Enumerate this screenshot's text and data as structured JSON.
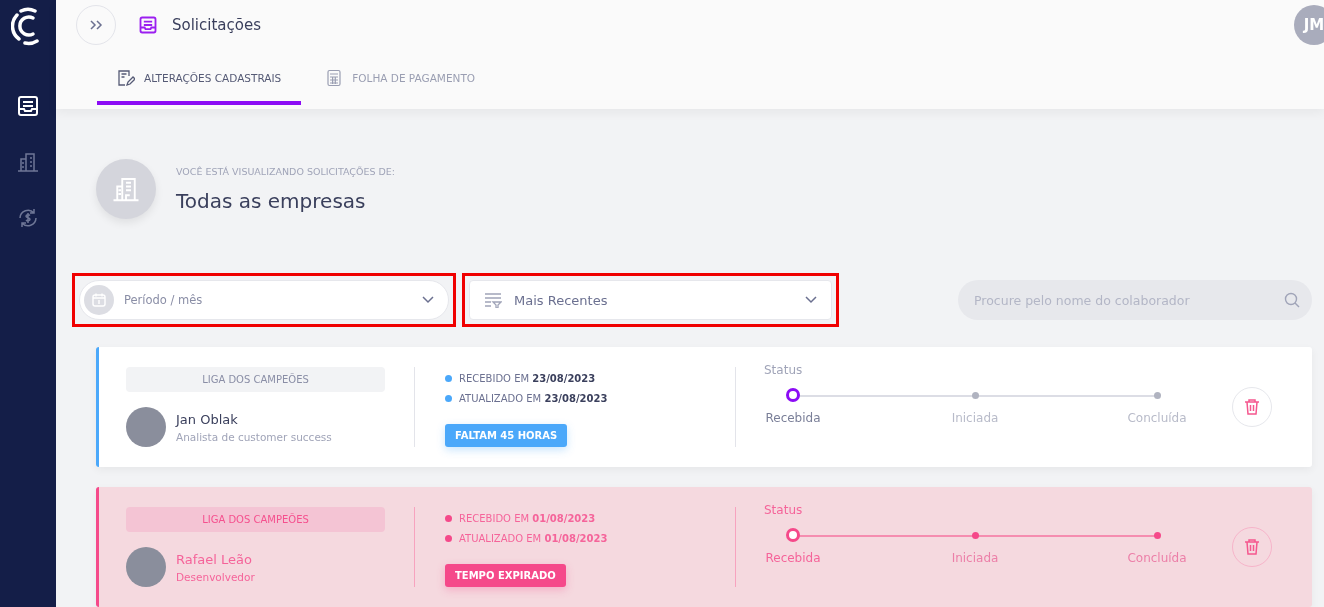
{
  "header": {
    "title": "Solicitações",
    "user_initials": "JM"
  },
  "tabs": [
    {
      "label": "ALTERAÇÕES CADASTRAIS",
      "selected": true,
      "kind": "edit"
    },
    {
      "label": "FOLHA DE PAGAMENTO",
      "selected": false,
      "kind": "calc"
    }
  ],
  "sidebar": {
    "items": [
      {
        "kind": "inbox",
        "selected": true
      },
      {
        "kind": "building",
        "selected": false
      },
      {
        "kind": "money",
        "selected": false
      }
    ]
  },
  "viewing": {
    "caption": "VOCÊ ESTÁ VISUALIZANDO SOLICITAÇÕES DE:",
    "company": "Todas as empresas"
  },
  "filters": {
    "period": {
      "placeholder": "Período / mês",
      "highlighted": true
    },
    "sort": {
      "value": "Mais Recentes",
      "highlighted": true
    },
    "search": {
      "placeholder": "Procure pelo nome do colaborador"
    }
  },
  "requests": [
    {
      "kind": "pending",
      "company": "LIGA DOS CAMPEÕES",
      "name": "Jan Oblak",
      "role": "Analista de customer success",
      "received_label": "RECEBIDO EM",
      "received": "23/08/2023",
      "updated_label": "ATUALIZADO EM",
      "updated": "23/08/2023",
      "badge": "FALTAM 45 HORAS",
      "status_label": "Status",
      "steps": [
        {
          "label": "Recebida",
          "current": true
        },
        {
          "label": "Iniciada",
          "current": false
        },
        {
          "label": "Concluída",
          "current": false
        }
      ]
    },
    {
      "kind": "expired",
      "company": "LIGA DOS CAMPEÕES",
      "name": "Rafael Leão",
      "role": "Desenvolvedor",
      "received_label": "RECEBIDO EM",
      "received": "01/08/2023",
      "updated_label": "ATUALIZADO EM",
      "updated": "01/08/2023",
      "badge": "TEMPO EXPIRADO",
      "status_label": "Status",
      "steps": [
        {
          "label": "Recebida",
          "current": true
        },
        {
          "label": "Iniciada",
          "current": false
        },
        {
          "label": "Concluída",
          "current": false
        }
      ]
    }
  ]
}
